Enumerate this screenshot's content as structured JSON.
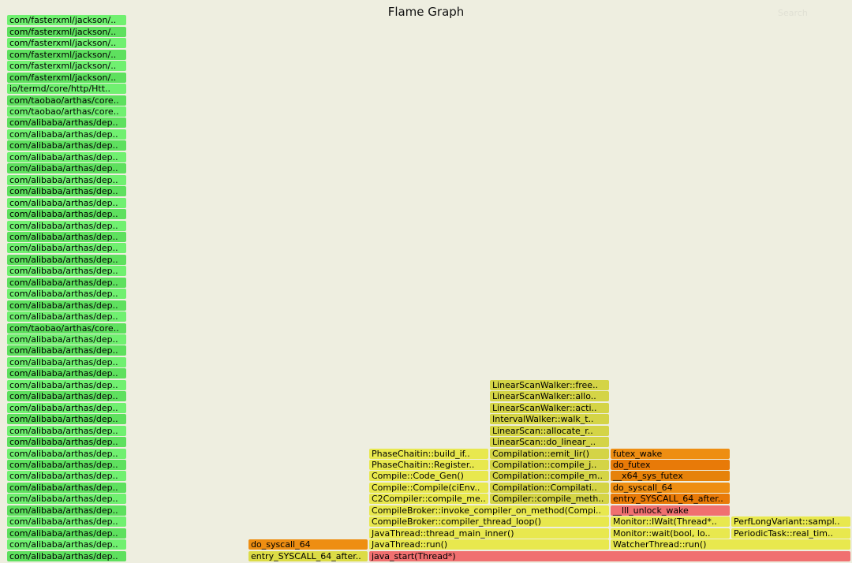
{
  "title": "Flame Graph",
  "search_label": "Search",
  "palette": {
    "green": [
      "#55d655",
      "#5ee05e",
      "#66e866",
      "#70f070"
    ],
    "yellow": [
      "#e2e24a",
      "#d4d446",
      "#e8e84e",
      "#dcdc46"
    ],
    "orange": [
      "#e6820a",
      "#ee8e12",
      "#e87a08"
    ],
    "red": "#f07070"
  },
  "frames": [
    {
      "label": "com/fasterxml/jackson/..",
      "color": "green",
      "col": 0,
      "span": 1,
      "row": 47
    },
    {
      "label": "com/fasterxml/jackson/..",
      "color": "green",
      "col": 0,
      "span": 1,
      "row": 46
    },
    {
      "label": "com/fasterxml/jackson/..",
      "color": "green",
      "col": 0,
      "span": 1,
      "row": 45
    },
    {
      "label": "com/fasterxml/jackson/..",
      "color": "green",
      "col": 0,
      "span": 1,
      "row": 44
    },
    {
      "label": "com/fasterxml/jackson/..",
      "color": "green",
      "col": 0,
      "span": 1,
      "row": 43
    },
    {
      "label": "com/fasterxml/jackson/..",
      "color": "green",
      "col": 0,
      "span": 1,
      "row": 42
    },
    {
      "label": "io/termd/core/http/Htt..",
      "color": "green",
      "col": 0,
      "span": 1,
      "row": 41
    },
    {
      "label": "com/taobao/arthas/core..",
      "color": "green",
      "col": 0,
      "span": 1,
      "row": 40
    },
    {
      "label": "com/taobao/arthas/core..",
      "color": "green",
      "col": 0,
      "span": 1,
      "row": 39
    },
    {
      "label": "com/alibaba/arthas/dep..",
      "color": "green",
      "col": 0,
      "span": 1,
      "row": 38
    },
    {
      "label": "com/alibaba/arthas/dep..",
      "color": "green",
      "col": 0,
      "span": 1,
      "row": 37
    },
    {
      "label": "com/alibaba/arthas/dep..",
      "color": "green",
      "col": 0,
      "span": 1,
      "row": 36
    },
    {
      "label": "com/alibaba/arthas/dep..",
      "color": "green",
      "col": 0,
      "span": 1,
      "row": 35
    },
    {
      "label": "com/alibaba/arthas/dep..",
      "color": "green",
      "col": 0,
      "span": 1,
      "row": 34
    },
    {
      "label": "com/alibaba/arthas/dep..",
      "color": "green",
      "col": 0,
      "span": 1,
      "row": 33
    },
    {
      "label": "com/alibaba/arthas/dep..",
      "color": "green",
      "col": 0,
      "span": 1,
      "row": 32
    },
    {
      "label": "com/alibaba/arthas/dep..",
      "color": "green",
      "col": 0,
      "span": 1,
      "row": 31
    },
    {
      "label": "com/alibaba/arthas/dep..",
      "color": "green",
      "col": 0,
      "span": 1,
      "row": 30
    },
    {
      "label": "com/alibaba/arthas/dep..",
      "color": "green",
      "col": 0,
      "span": 1,
      "row": 29
    },
    {
      "label": "com/alibaba/arthas/dep..",
      "color": "green",
      "col": 0,
      "span": 1,
      "row": 28
    },
    {
      "label": "com/alibaba/arthas/dep..",
      "color": "green",
      "col": 0,
      "span": 1,
      "row": 27
    },
    {
      "label": "com/alibaba/arthas/dep..",
      "color": "green",
      "col": 0,
      "span": 1,
      "row": 26
    },
    {
      "label": "com/alibaba/arthas/dep..",
      "color": "green",
      "col": 0,
      "span": 1,
      "row": 25
    },
    {
      "label": "com/alibaba/arthas/dep..",
      "color": "green",
      "col": 0,
      "span": 1,
      "row": 24
    },
    {
      "label": "com/alibaba/arthas/dep..",
      "color": "green",
      "col": 0,
      "span": 1,
      "row": 23
    },
    {
      "label": "com/alibaba/arthas/dep..",
      "color": "green",
      "col": 0,
      "span": 1,
      "row": 22
    },
    {
      "label": "com/alibaba/arthas/dep..",
      "color": "green",
      "col": 0,
      "span": 1,
      "row": 21
    },
    {
      "label": "com/taobao/arthas/core..",
      "color": "green",
      "col": 0,
      "span": 1,
      "row": 20
    },
    {
      "label": "com/alibaba/arthas/dep..",
      "color": "green",
      "col": 0,
      "span": 1,
      "row": 19
    },
    {
      "label": "com/alibaba/arthas/dep..",
      "color": "green",
      "col": 0,
      "span": 1,
      "row": 18
    },
    {
      "label": "com/alibaba/arthas/dep..",
      "color": "green",
      "col": 0,
      "span": 1,
      "row": 17
    },
    {
      "label": "com/alibaba/arthas/dep..",
      "color": "green",
      "col": 0,
      "span": 1,
      "row": 16
    },
    {
      "label": "com/alibaba/arthas/dep..",
      "color": "green",
      "col": 0,
      "span": 1,
      "row": 15
    },
    {
      "label": "com/alibaba/arthas/dep..",
      "color": "green",
      "col": 0,
      "span": 1,
      "row": 14
    },
    {
      "label": "com/alibaba/arthas/dep..",
      "color": "green",
      "col": 0,
      "span": 1,
      "row": 13
    },
    {
      "label": "com/alibaba/arthas/dep..",
      "color": "green",
      "col": 0,
      "span": 1,
      "row": 12
    },
    {
      "label": "com/alibaba/arthas/dep..",
      "color": "green",
      "col": 0,
      "span": 1,
      "row": 11
    },
    {
      "label": "com/alibaba/arthas/dep..",
      "color": "green",
      "col": 0,
      "span": 1,
      "row": 10
    },
    {
      "label": "com/alibaba/arthas/dep..",
      "color": "green",
      "col": 0,
      "span": 1,
      "row": 9
    },
    {
      "label": "com/alibaba/arthas/dep..",
      "color": "green",
      "col": 0,
      "span": 1,
      "row": 8
    },
    {
      "label": "com/alibaba/arthas/dep..",
      "color": "green",
      "col": 0,
      "span": 1,
      "row": 7
    },
    {
      "label": "com/alibaba/arthas/dep..",
      "color": "green",
      "col": 0,
      "span": 1,
      "row": 6
    },
    {
      "label": "com/alibaba/arthas/dep..",
      "color": "green",
      "col": 0,
      "span": 1,
      "row": 5
    },
    {
      "label": "com/alibaba/arthas/dep..",
      "color": "green",
      "col": 0,
      "span": 1,
      "row": 4
    },
    {
      "label": "com/alibaba/arthas/dep..",
      "color": "green",
      "col": 0,
      "span": 1,
      "row": 3
    },
    {
      "label": "com/alibaba/arthas/dep..",
      "color": "green",
      "col": 0,
      "span": 1,
      "row": 2
    },
    {
      "label": "com/alibaba/arthas/dep..",
      "color": "green",
      "col": 0,
      "span": 1,
      "row": 1
    },
    {
      "label": "com/alibaba/arthas/dep..",
      "color": "green",
      "col": 0,
      "span": 1,
      "row": 0
    },
    {
      "label": "do_syscall_64",
      "color": "orange",
      "col": 2,
      "span": 1,
      "row": 1
    },
    {
      "label": "entry_SYSCALL_64_after..",
      "color": "yellow",
      "col": 2,
      "span": 1,
      "row": 0
    },
    {
      "label": "java_start(Thread*)",
      "color": "red",
      "col": 3,
      "span": 4,
      "row": 0
    },
    {
      "label": "JavaThread::run()",
      "color": "yellow",
      "col": 3,
      "span": 2,
      "row": 1
    },
    {
      "label": "JavaThread::thread_main_inner()",
      "color": "yellow",
      "col": 3,
      "span": 2,
      "row": 2
    },
    {
      "label": "CompileBroker::compiler_thread_loop()",
      "color": "yellow",
      "col": 3,
      "span": 2,
      "row": 3
    },
    {
      "label": "CompileBroker::invoke_compiler_on_method(Compi..",
      "color": "yellow",
      "col": 3,
      "span": 2,
      "row": 4
    },
    {
      "label": "C2Compiler::compile_me..",
      "color": "yellow",
      "col": 3,
      "span": 1,
      "row": 5
    },
    {
      "label": "Compile::Compile(ciEnv..",
      "color": "yellow",
      "col": 3,
      "span": 1,
      "row": 6
    },
    {
      "label": "Compile::Code_Gen()",
      "color": "yellow",
      "col": 3,
      "span": 1,
      "row": 7
    },
    {
      "label": "PhaseChaitin::Register..",
      "color": "yellow",
      "col": 3,
      "span": 1,
      "row": 8
    },
    {
      "label": "PhaseChaitin::build_if..",
      "color": "yellow",
      "col": 3,
      "span": 1,
      "row": 9
    },
    {
      "label": "Compiler::compile_meth..",
      "color": "yellow",
      "col": 4,
      "span": 1,
      "row": 5
    },
    {
      "label": "Compilation::Compilati..",
      "color": "yellow",
      "col": 4,
      "span": 1,
      "row": 6
    },
    {
      "label": "Compilation::compile_m..",
      "color": "yellow",
      "col": 4,
      "span": 1,
      "row": 7
    },
    {
      "label": "Compilation::compile_j..",
      "color": "yellow",
      "col": 4,
      "span": 1,
      "row": 8
    },
    {
      "label": "Compilation::emit_lir()",
      "color": "yellow",
      "col": 4,
      "span": 1,
      "row": 9
    },
    {
      "label": "LinearScan::do_linear_..",
      "color": "yellow",
      "col": 4,
      "span": 1,
      "row": 10
    },
    {
      "label": "LinearScan::allocate_r..",
      "color": "yellow",
      "col": 4,
      "span": 1,
      "row": 11
    },
    {
      "label": "IntervalWalker::walk_t..",
      "color": "yellow",
      "col": 4,
      "span": 1,
      "row": 12
    },
    {
      "label": "LinearScanWalker::acti..",
      "color": "yellow",
      "col": 4,
      "span": 1,
      "row": 13
    },
    {
      "label": "LinearScanWalker::allo..",
      "color": "yellow",
      "col": 4,
      "span": 1,
      "row": 14
    },
    {
      "label": "LinearScanWalker::free..",
      "color": "yellow",
      "col": 4,
      "span": 1,
      "row": 15
    },
    {
      "label": "WatcherThread::run()",
      "color": "yellow",
      "col": 5,
      "span": 2,
      "row": 1
    },
    {
      "label": "Monitor::wait(bool, lo..",
      "color": "yellow",
      "col": 5,
      "span": 1,
      "row": 2
    },
    {
      "label": "Monitor::IWait(Thread*..",
      "color": "yellow",
      "col": 5,
      "span": 1,
      "row": 3
    },
    {
      "label": "__lll_unlock_wake",
      "color": "red",
      "col": 5,
      "span": 1,
      "row": 4
    },
    {
      "label": "entry_SYSCALL_64_after..",
      "color": "orange",
      "col": 5,
      "span": 1,
      "row": 5
    },
    {
      "label": "do_syscall_64",
      "color": "orange",
      "col": 5,
      "span": 1,
      "row": 6
    },
    {
      "label": "__x64_sys_futex",
      "color": "orange",
      "col": 5,
      "span": 1,
      "row": 7
    },
    {
      "label": "do_futex",
      "color": "orange",
      "col": 5,
      "span": 1,
      "row": 8
    },
    {
      "label": "futex_wake",
      "color": "orange",
      "col": 5,
      "span": 1,
      "row": 9
    },
    {
      "label": "PeriodicTask::real_tim..",
      "color": "yellow",
      "col": 6,
      "span": 1,
      "row": 2
    },
    {
      "label": "PerfLongVariant::sampl..",
      "color": "yellow",
      "col": 6,
      "span": 1,
      "row": 3
    }
  ]
}
